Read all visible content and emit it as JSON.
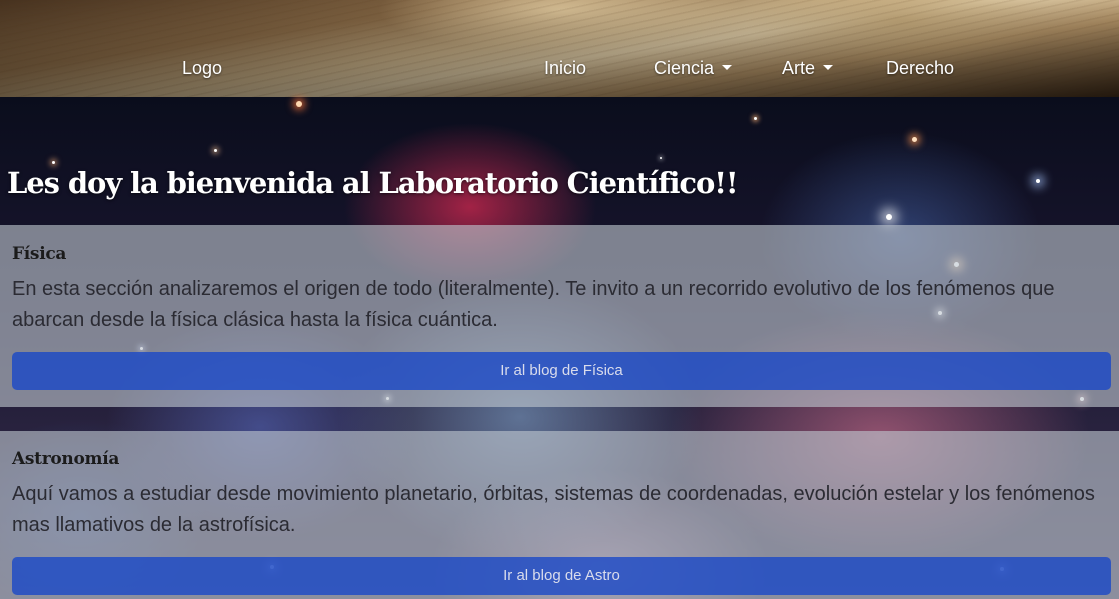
{
  "navbar": {
    "logo": "Logo",
    "links": [
      {
        "label": "Inicio",
        "dropdown": false
      },
      {
        "label": "Ciencia",
        "dropdown": true
      },
      {
        "label": "Arte",
        "dropdown": true
      },
      {
        "label": "Derecho",
        "dropdown": false
      }
    ]
  },
  "hero": {
    "heading": "Les doy la bienvenida al Laboratorio Científico!!"
  },
  "cards": [
    {
      "title": "Física",
      "text": "En esta sección analizaremos el origen de todo (literalmente). Te invito a un recorrido evolutivo de los fenómenos que abarcan desde la física clásica hasta la física cuántica.",
      "button": "Ir al blog de Física"
    },
    {
      "title": "Astronomía",
      "text": "Aquí vamos a estudiar desde movimiento planetario, órbitas, sistemas de coordenadas, evolución estelar y los fenómenos mas llamativos de la astrofísica.",
      "button": "Ir al blog de Astro"
    }
  ],
  "colors": {
    "button_bg": "#1746c8",
    "card_bg": "#bec6ce",
    "nav_text": "#ffffff"
  },
  "icons": {
    "dropdown": "caret-down-icon"
  }
}
